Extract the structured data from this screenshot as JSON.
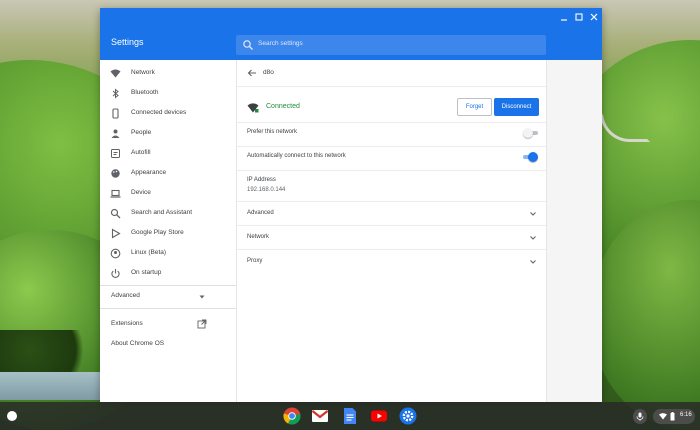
{
  "app": {
    "title": "Settings",
    "search_placeholder": "Search settings"
  },
  "window_controls": [
    "minimize",
    "maximize",
    "close"
  ],
  "sidebar": {
    "items": [
      {
        "label": "Network",
        "icon": "wifi-icon"
      },
      {
        "label": "Bluetooth",
        "icon": "bluetooth-icon"
      },
      {
        "label": "Connected devices",
        "icon": "phone-icon"
      },
      {
        "label": "People",
        "icon": "person-icon"
      },
      {
        "label": "Autofill",
        "icon": "autofill-icon"
      },
      {
        "label": "Appearance",
        "icon": "palette-icon"
      },
      {
        "label": "Device",
        "icon": "laptop-icon"
      },
      {
        "label": "Search and Assistant",
        "icon": "search-icon"
      },
      {
        "label": "Google Play Store",
        "icon": "play-store-icon"
      },
      {
        "label": "Linux (Beta)",
        "icon": "linux-icon"
      },
      {
        "label": "On startup",
        "icon": "power-icon"
      }
    ],
    "advanced_label": "Advanced",
    "extensions_label": "Extensions",
    "about_label": "About Chrome OS"
  },
  "network_detail": {
    "network_name": "d8o",
    "status": "Connected",
    "forget_label": "Forget",
    "disconnect_label": "Disconnect",
    "prefer_label": "Prefer this network",
    "prefer_enabled": false,
    "auto_connect_label": "Automatically connect to this network",
    "auto_connect_enabled": true,
    "ip_label": "IP Address",
    "ip_value": "192.168.0.144",
    "sections": [
      "Advanced",
      "Network",
      "Proxy"
    ]
  },
  "shelf": {
    "apps": [
      "chrome-icon",
      "gmail-icon",
      "docs-icon",
      "youtube-icon",
      "settings-icon"
    ],
    "time": "6:16"
  },
  "colors": {
    "accent": "#1a73e8",
    "connected": "#1e8e3e"
  }
}
